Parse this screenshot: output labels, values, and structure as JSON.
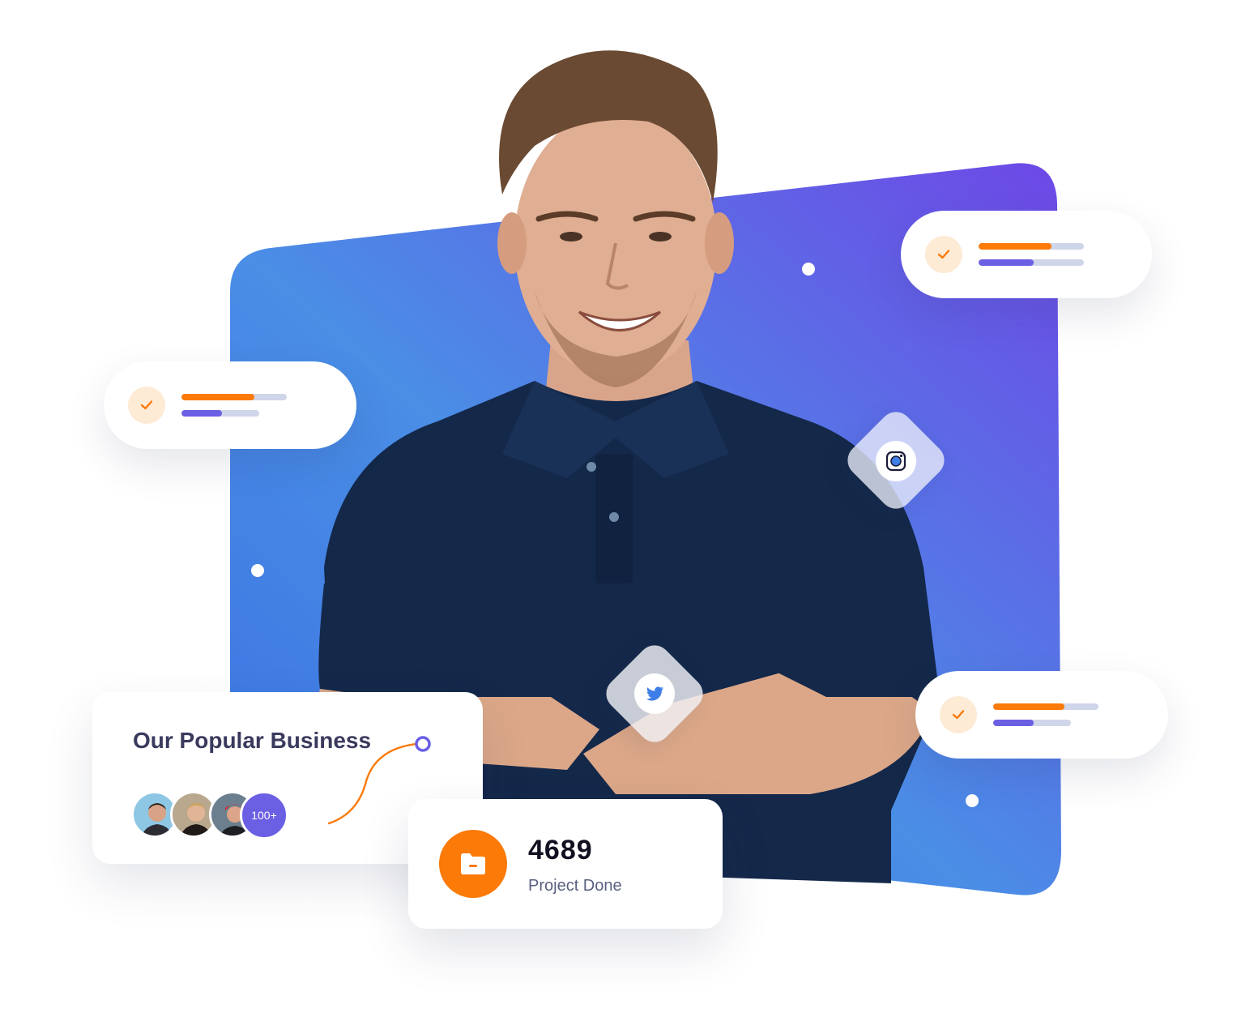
{
  "colors": {
    "gradient_start": "#3f7ee6",
    "gradient_mid": "#4a8ce3",
    "gradient_end": "#6a4ee6",
    "accent_orange": "#fb7a08",
    "accent_purple": "#6b5fe4",
    "check_bg": "#fdebd6",
    "bar_track": "#cfd6ea"
  },
  "progress_cards": [
    {
      "icon": "check-icon",
      "bar_top_fraction": 0.69,
      "bar_bottom_fraction": 0.52
    },
    {
      "icon": "check-icon",
      "bar_top_fraction": 0.69,
      "bar_bottom_fraction": 0.52
    },
    {
      "icon": "check-icon",
      "bar_top_fraction": 0.68,
      "bar_bottom_fraction": 0.52
    }
  ],
  "social_badges": [
    {
      "icon": "instagram-icon"
    },
    {
      "icon": "twitter-icon"
    }
  ],
  "business": {
    "title": "Our Popular Business",
    "avatar_count": "100+"
  },
  "project": {
    "number": "4689",
    "label": "Project Done",
    "icon": "folder-icon"
  }
}
